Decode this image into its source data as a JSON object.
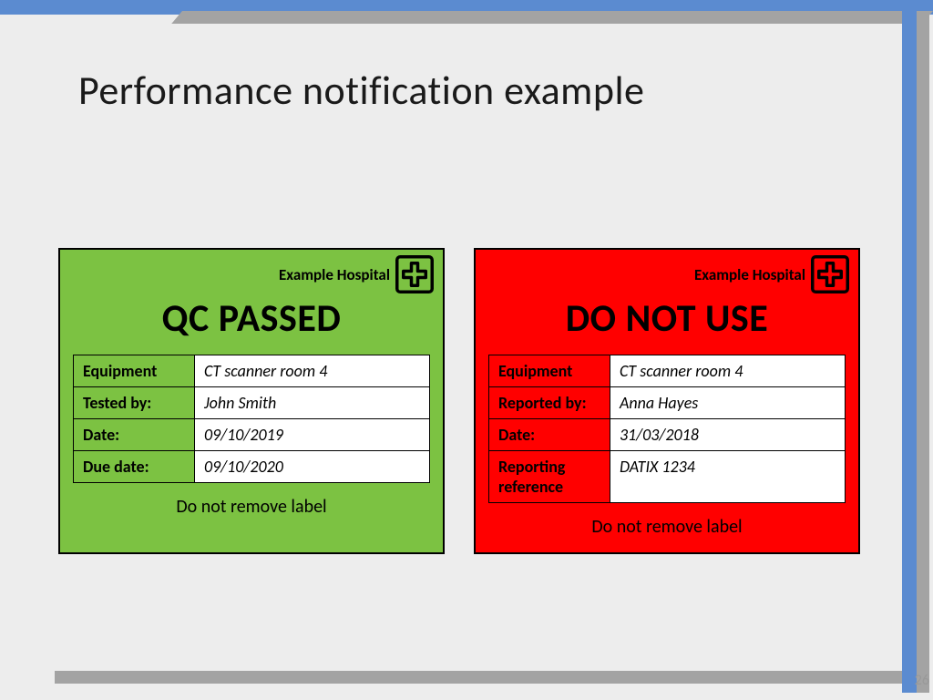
{
  "slide": {
    "title": "Performance notification example",
    "pageNumber": "26"
  },
  "cards": {
    "pass": {
      "hospital": "Example Hospital",
      "heading": "QC PASSED",
      "rows": [
        {
          "label": "Equipment",
          "value": "CT scanner room 4"
        },
        {
          "label": "Tested by:",
          "value": "John Smith"
        },
        {
          "label": "Date:",
          "value": "09/10/2019"
        },
        {
          "label": "Due date:",
          "value": "09/10/2020"
        }
      ],
      "footer": "Do not remove label"
    },
    "fail": {
      "hospital": "Example Hospital",
      "heading": "DO NOT USE",
      "rows": [
        {
          "label": "Equipment",
          "value": "CT scanner room 4"
        },
        {
          "label": "Reported by:",
          "value": "Anna Hayes"
        },
        {
          "label": "Date:",
          "value": "31/03/2018"
        },
        {
          "label": "Reporting reference",
          "value": "DATIX 1234"
        }
      ],
      "footer": "Do not remove label"
    }
  }
}
